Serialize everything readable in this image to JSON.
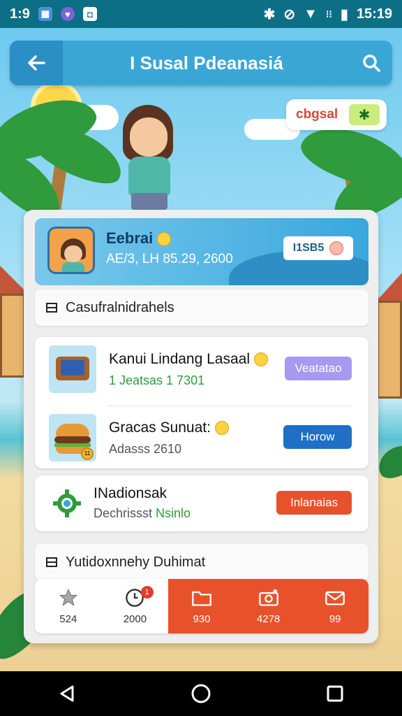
{
  "status_bar": {
    "time_left": "1:9",
    "time_right": "15:19",
    "icons": [
      "image-icon",
      "heart-icon",
      "app-icon",
      "bluetooth-icon",
      "do-not-disturb-icon",
      "wifi-icon",
      "signal-icon",
      "battery-icon"
    ]
  },
  "app_bar": {
    "title": "I Susal Pdeanasiá",
    "back_icon": "arrow-left-icon",
    "search_icon": "search-icon"
  },
  "chip": {
    "label": "cbgsal",
    "icon": "star-icon"
  },
  "profile": {
    "name": "Eebrai",
    "stats": "AE/3, LH 85.29, 2600",
    "tag": "I1SB5"
  },
  "section_1": {
    "title": "Casufralnidrahels"
  },
  "list_items": [
    {
      "title": "Kanui Lindang Lasaal",
      "subtitle": "1 Jeatsas 1 7301",
      "button": "Veatatao",
      "thumb": "tablet-icon"
    },
    {
      "title": "Gracas Sunuat:",
      "subtitle": "Adasss 2610",
      "button": "Horow",
      "thumb": "burger-icon"
    }
  ],
  "notification": {
    "title": "INadionsak",
    "subtitle_gray": "Dechrissst",
    "subtitle_green": "Nsinlo",
    "button": "Inlanaias"
  },
  "section_2": {
    "title": "Yutidoxnnehy Duhimat"
  },
  "tabs": [
    {
      "icon": "star-icon",
      "count": "524"
    },
    {
      "icon": "clock-icon",
      "count": "2000",
      "badge": "1"
    },
    {
      "icon": "folder-icon",
      "count": "930"
    },
    {
      "icon": "camera-icon",
      "count": "4278"
    },
    {
      "icon": "mail-icon",
      "count": "99"
    }
  ],
  "colors": {
    "status_bar": "#0c6f86",
    "app_bar": "#3aa6d6",
    "accent_orange": "#e8522b",
    "button_purple": "#a59af0",
    "button_blue": "#1f6fc4",
    "button_red": "#e8522b"
  }
}
